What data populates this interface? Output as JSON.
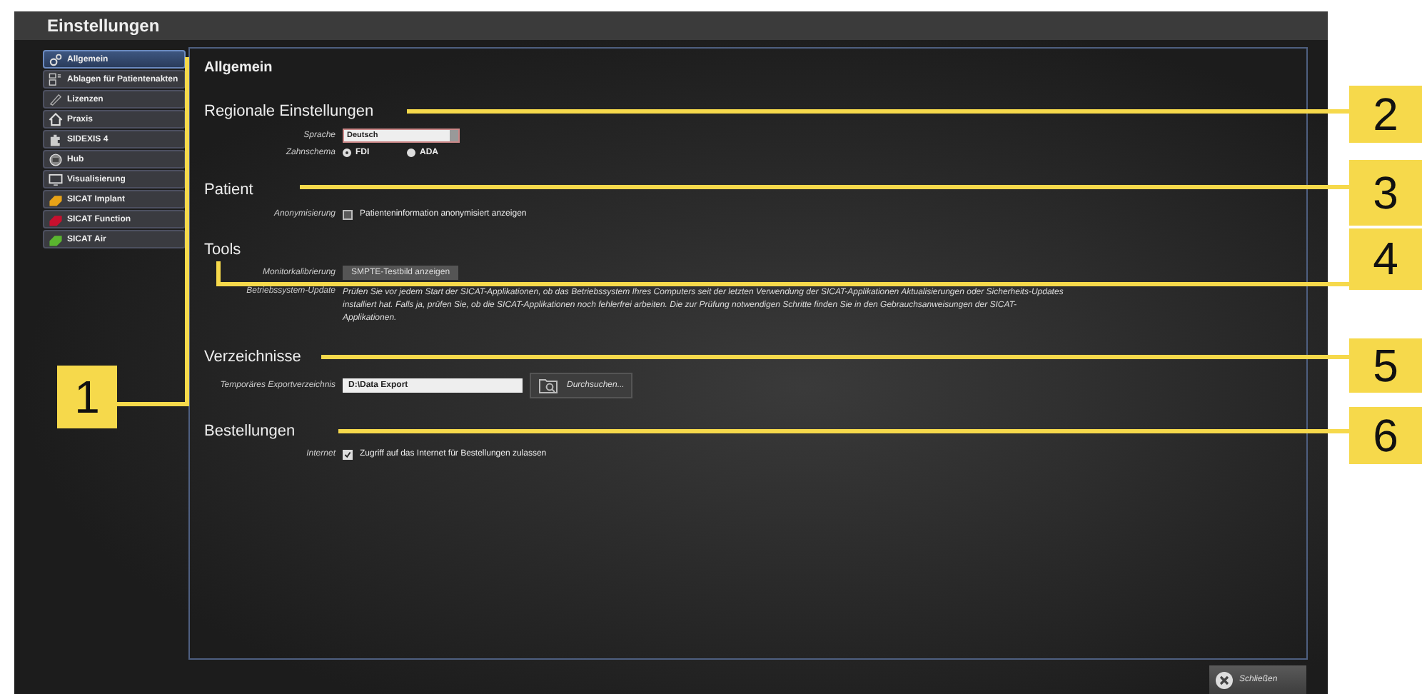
{
  "window": {
    "title": "Einstellungen"
  },
  "sidebar": {
    "items": [
      {
        "label": "Allgemein",
        "selected": true
      },
      {
        "label": "Ablagen für Patientenakten",
        "selected": false
      },
      {
        "label": "Lizenzen",
        "selected": false
      },
      {
        "label": "Praxis",
        "selected": false
      },
      {
        "label": "SIDEXIS 4",
        "selected": false
      },
      {
        "label": "Hub",
        "selected": false
      },
      {
        "label": "Visualisierung",
        "selected": false
      },
      {
        "label": "SICAT Implant",
        "selected": false,
        "color": "#e8a317"
      },
      {
        "label": "SICAT Function",
        "selected": false,
        "color": "#c8102e"
      },
      {
        "label": "SICAT Air",
        "selected": false,
        "color": "#5ab52f"
      }
    ]
  },
  "panel": {
    "title": "Allgemein",
    "regional": {
      "heading": "Regionale Einstellungen",
      "language_label": "Sprache",
      "language_value": "Deutsch",
      "scheme_label": "Zahnschema",
      "scheme_options": [
        {
          "label": "FDI",
          "selected": true
        },
        {
          "label": "ADA",
          "selected": false
        }
      ]
    },
    "patient": {
      "heading": "Patient",
      "label": "Anonymisierung",
      "checkbox": {
        "label": "Patienteninformation anonymisiert anzeigen",
        "checked": false
      }
    },
    "tools": {
      "heading": "Tools",
      "calibration_label": "Monitorkalibrierung",
      "calibration_button": "SMPTE-Testbild anzeigen",
      "update_label": "Betriebssystem-Update",
      "update_text": "Prüfen Sie vor jedem Start der SICAT-Applikationen, ob das Betriebssystem Ihres Computers seit der letzten Verwendung der SICAT-Applikationen Aktualisierungen oder Sicherheits-Updates installiert hat. Falls ja, prüfen Sie, ob die SICAT-Applikationen noch fehlerfrei arbeiten. Die zur Prüfung notwendigen Schritte finden Sie in den Gebrauchsanweisungen der SICAT-Applikationen."
    },
    "directories": {
      "heading": "Verzeichnisse",
      "label": "Temporäres Exportverzeichnis",
      "value": "D:\\Data Export",
      "browse_button": "Durchsuchen..."
    },
    "orders": {
      "heading": "Bestellungen",
      "label": "Internet",
      "checkbox": {
        "label": "Zugriff auf das Internet für Bestellungen zulassen",
        "checked": true
      }
    }
  },
  "close_button": "Schließen",
  "callouts": [
    {
      "number": "1"
    },
    {
      "number": "2"
    },
    {
      "number": "3"
    },
    {
      "number": "4"
    },
    {
      "number": "5"
    },
    {
      "number": "6"
    }
  ]
}
